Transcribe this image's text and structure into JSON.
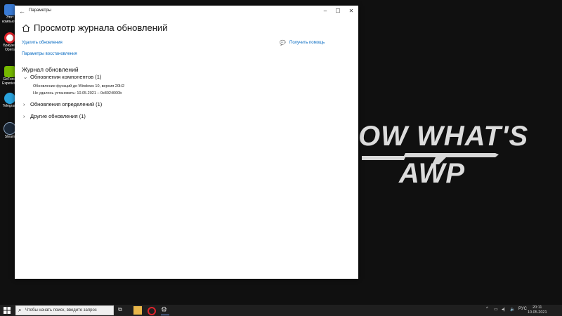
{
  "window": {
    "title": "Параметры",
    "page_title": "Просмотр журнала обновлений",
    "links": {
      "remove_updates": "Удалить обновления",
      "recovery_options": "Параметры восстановления",
      "get_help": "Получить помощь"
    },
    "section_title": "Журнал обновлений",
    "groups": [
      {
        "label": "Обновления компонентов (1)",
        "expanded": true,
        "entries": [
          "Обновление функций до Windows 10, версия 20H2",
          "Не удалось установить: 10.05.2021 – 0x8024000b"
        ]
      },
      {
        "label": "Обновления определений (1)",
        "expanded": false
      },
      {
        "label": "Другие обновления (1)",
        "expanded": false
      }
    ]
  },
  "desktop": {
    "wallpaper_text_line1": "OW WHAT'S",
    "wallpaper_text_line2": "AWP",
    "icons": [
      {
        "label": "Этот компьютер",
        "icon": "computer-icon",
        "color": "#3a7bd5"
      },
      {
        "label": "Браузер Opera",
        "icon": "opera-icon",
        "color": "#e0242c"
      },
      {
        "label": "GeForce Experience",
        "icon": "nvidia-icon",
        "color": "#76b900"
      },
      {
        "label": "Telegram",
        "icon": "telegram-icon",
        "color": "#2aa3de"
      },
      {
        "label": "Steam",
        "icon": "steam-icon",
        "color": "#1b2838"
      }
    ]
  },
  "taskbar": {
    "search_placeholder": "Чтобы начать поиск, введите запрос",
    "language": "РУС",
    "time": "20:11",
    "date": "10.05.2021"
  },
  "colors": {
    "accent_link": "#0067c0",
    "taskbar_bg": "#1f1f1f"
  }
}
